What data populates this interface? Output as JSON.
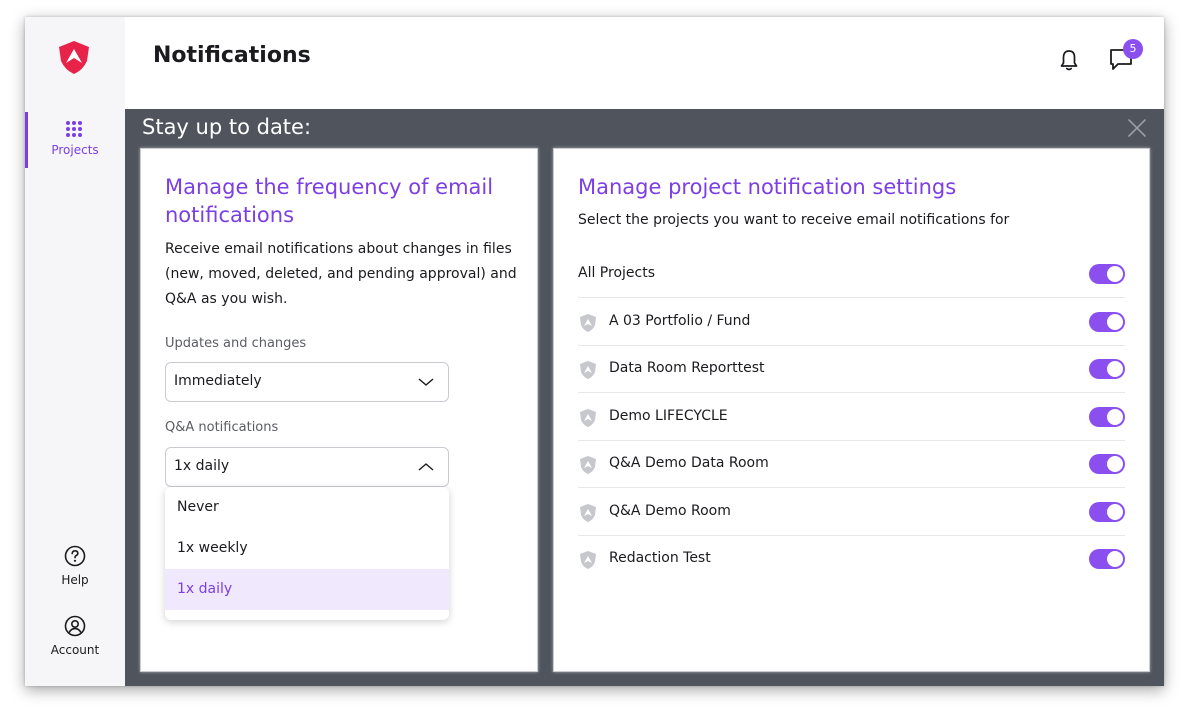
{
  "header": {
    "title": "Notifications",
    "message_badge": "5"
  },
  "sidebar": {
    "items": [
      {
        "label": "Projects",
        "icon": "grid-icon",
        "active": true
      },
      {
        "label": "Help",
        "icon": "help-icon",
        "active": false
      },
      {
        "label": "Account",
        "icon": "account-icon",
        "active": false
      }
    ]
  },
  "banner": {
    "title": "Stay up to date:"
  },
  "email_frequency": {
    "heading": "Manage the frequency of email notifications",
    "description": "Receive email notifications about changes in files (new, moved, deleted, and pending approval) and Q&A as you wish.",
    "updates_label": "Updates and changes",
    "updates_value": "Immediately",
    "qa_label": "Q&A notifications",
    "qa_value": "1x daily",
    "qa_options": [
      "Never",
      "1x weekly",
      "1x daily"
    ]
  },
  "project_settings": {
    "heading": "Manage project notification settings",
    "subtitle": "Select the projects you want to receive email notifications for",
    "all_projects_label": "All Projects",
    "all_projects_enabled": true,
    "projects": [
      {
        "name": "A 03 Portfolio / Fund",
        "enabled": true
      },
      {
        "name": "Data Room Reporttest",
        "enabled": true
      },
      {
        "name": "Demo LIFECYCLE",
        "enabled": true
      },
      {
        "name": "Q&A Demo Data Room",
        "enabled": true
      },
      {
        "name": "Q&A Demo Room",
        "enabled": true
      },
      {
        "name": "Redaction Test",
        "enabled": true
      }
    ]
  },
  "colors": {
    "accent": "#7b3fe4",
    "brand": "#e8234a",
    "overlay": "#50545c"
  }
}
